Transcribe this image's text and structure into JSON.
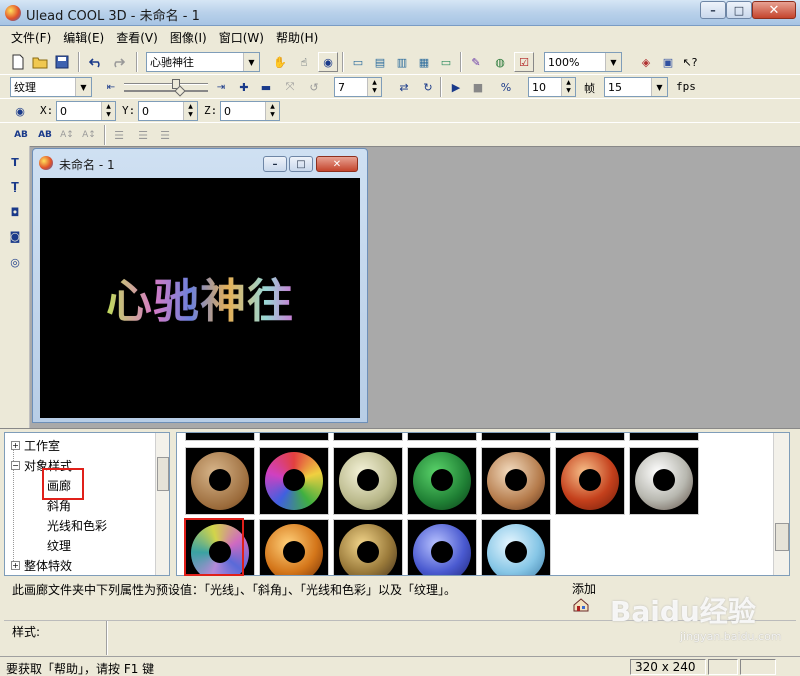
{
  "window": {
    "title": "Ulead COOL 3D - 未命名 - 1",
    "minimize": "–",
    "maximize": "□",
    "close": "✕"
  },
  "menu": [
    "文件(F)",
    "编辑(E)",
    "查看(V)",
    "图像(I)",
    "窗口(W)",
    "帮助(H)"
  ],
  "toolbar1": {
    "object_combo": "心驰神往",
    "zoom_combo": "100%"
  },
  "toolbar2": {
    "attribute_combo": "纹理",
    "frame_value": "7",
    "frame_count": "10",
    "frame_label": "帧",
    "fps_value": "15",
    "fps_label": "fps"
  },
  "toolbar3": {
    "x_label": "X:",
    "x_value": "0",
    "y_label": "Y:",
    "y_value": "0",
    "z_label": "Z:",
    "z_value": "0"
  },
  "child_window": {
    "title": "未命名 - 1",
    "canvas_text": "心驰神往"
  },
  "tree": {
    "items": [
      {
        "label": "工作室",
        "expander": "+"
      },
      {
        "label": "对象样式",
        "expander": "−"
      },
      {
        "label": "画廊",
        "selected": true
      },
      {
        "label": "斜角"
      },
      {
        "label": "光线和色彩"
      },
      {
        "label": "纹理"
      },
      {
        "label": "整体特效",
        "expander": "+"
      }
    ]
  },
  "gallery": {
    "accent_selection_color": "#e0201a",
    "rows": 2,
    "row1_count": 7,
    "row2_count": 5,
    "selected_index": 7
  },
  "description": "此画廊文件夹中下列属性为预设值：「光线」、「斜角」、「光线和色彩」以及「纹理」。",
  "add_button": {
    "label": "添加"
  },
  "style_label": "样式:",
  "status": {
    "message": "要获取「帮助」，请按 F1 键",
    "size": "320 x 240"
  },
  "watermark": {
    "brand": "Baidu经验",
    "url": "jingyan.baidu.com"
  }
}
